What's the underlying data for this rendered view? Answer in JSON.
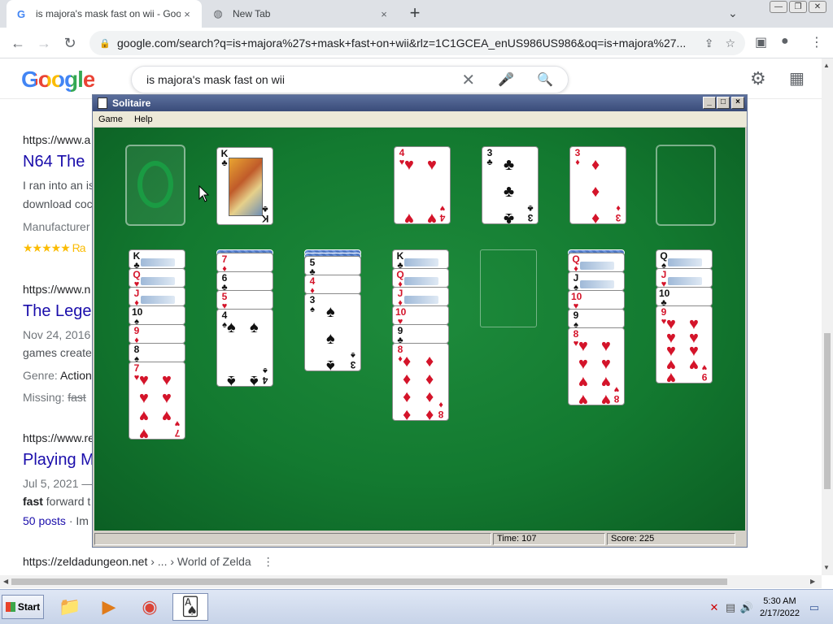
{
  "browser": {
    "tabs": [
      {
        "title": "is majora's mask fast on wii - Goog",
        "favicon": "G",
        "close": "×"
      },
      {
        "title": "New Tab",
        "favicon": "◍",
        "close": "×"
      }
    ],
    "new_tab": "+",
    "tab_menu": "⌄",
    "url": "google.com/search?q=is+majora%27s+mask+fast+on+wii&rlz=1C1GCEA_enUS986US986&oq=is+majora%27...",
    "icons": {
      "back": "←",
      "forward": "→",
      "reload": "↻",
      "lock": "🔒",
      "share": "⇪",
      "star": "☆",
      "sidebar": "▣",
      "profile": "●",
      "menu": "⋮"
    }
  },
  "google": {
    "logo": "Google",
    "query": "is majora's mask fast on wii",
    "clear": "✕",
    "mic": "🎤",
    "search": "🔍",
    "settings": "⚙",
    "apps": "⋮⋮⋮",
    "results": [
      {
        "url": "https://www.a",
        "title": "N64 The",
        "snippet1": "I ran into an is",
        "snippet2": "download coc",
        "meta": "Manufacturer",
        "rating": "★★★★★ Ra"
      },
      {
        "url": "https://www.n",
        "title": "The Lege",
        "date": "Nov 24, 2016",
        "snippet": "games create",
        "genre_label": "Genre:",
        "genre": "Action",
        "missing_label": "Missing:",
        "missing": "fast"
      },
      {
        "url": "https://www.re",
        "title": "Playing M",
        "date": "Jul 5, 2021 —",
        "snippet_bold": "fast",
        "snippet": " forward t",
        "posts": "50 posts",
        "posts_sep": " · Im"
      }
    ],
    "bottom_result": {
      "url": "https://zeldadungeon.net",
      "path": " › ... › World of Zelda",
      "more": "⋮"
    }
  },
  "solitaire": {
    "title": "Solitaire",
    "menu": [
      "Game",
      "Help"
    ],
    "controls": {
      "minimize": "_",
      "maximize": "□",
      "close": "×"
    },
    "status": {
      "time": "Time:  107",
      "score": "Score: 225"
    },
    "waste": {
      "rank": "K",
      "suit": "♣",
      "color": "black"
    },
    "foundations": [
      {
        "rank": "4",
        "suit": "♥",
        "color": "red"
      },
      {
        "rank": "3",
        "suit": "♣",
        "color": "black"
      },
      {
        "rank": "3",
        "suit": "♦",
        "color": "red"
      },
      {
        "rank": "",
        "suit": "",
        "color": ""
      }
    ],
    "tableau": [
      {
        "hidden": 0,
        "cards": [
          [
            "K",
            "♣",
            "black"
          ],
          [
            "Q",
            "♥",
            "red"
          ],
          [
            "J",
            "♦",
            "red"
          ],
          [
            "10",
            "♠",
            "black"
          ],
          [
            "9",
            "♦",
            "red"
          ],
          [
            "8",
            "♠",
            "black"
          ],
          [
            "7",
            "♥",
            "red"
          ]
        ]
      },
      {
        "hidden": 1,
        "cards": [
          [
            "7",
            "♦",
            "red"
          ],
          [
            "6",
            "♣",
            "black"
          ],
          [
            "5",
            "♥",
            "red"
          ],
          [
            "4",
            "♠",
            "black"
          ]
        ]
      },
      {
        "hidden": 2,
        "cards": [
          [
            "5",
            "♣",
            "black"
          ],
          [
            "4",
            "♦",
            "red"
          ],
          [
            "3",
            "♠",
            "black"
          ]
        ]
      },
      {
        "hidden": 0,
        "cards": [
          [
            "K",
            "♣",
            "black"
          ],
          [
            "Q",
            "♦",
            "red"
          ],
          [
            "J",
            "♦",
            "red"
          ],
          [
            "10",
            "♥",
            "red"
          ],
          [
            "9",
            "♣",
            "black"
          ],
          [
            "8",
            "♦",
            "red"
          ]
        ]
      },
      {
        "hidden": 0,
        "cards": []
      },
      {
        "hidden": 1,
        "cards": [
          [
            "Q",
            "♦",
            "red"
          ],
          [
            "J",
            "♠",
            "black"
          ],
          [
            "10",
            "♥",
            "red"
          ],
          [
            "9",
            "♠",
            "black"
          ],
          [
            "8",
            "♥",
            "red"
          ]
        ]
      },
      {
        "hidden": 0,
        "cards": [
          [
            "Q",
            "♠",
            "black"
          ],
          [
            "J",
            "♥",
            "red"
          ],
          [
            "10",
            "♣",
            "black"
          ],
          [
            "9",
            "♥",
            "red"
          ]
        ]
      }
    ]
  },
  "taskbar": {
    "start": "Start",
    "apps": [
      {
        "name": "explorer",
        "glyph": "📁"
      },
      {
        "name": "media-player",
        "glyph": "▶"
      },
      {
        "name": "chrome",
        "glyph": "◉"
      },
      {
        "name": "solitaire",
        "glyph": "🂡"
      }
    ],
    "tray": [
      "✕",
      "▤",
      "🔊"
    ],
    "time": "5:30 AM",
    "date": "2/17/2022",
    "show_desktop": "▭"
  }
}
